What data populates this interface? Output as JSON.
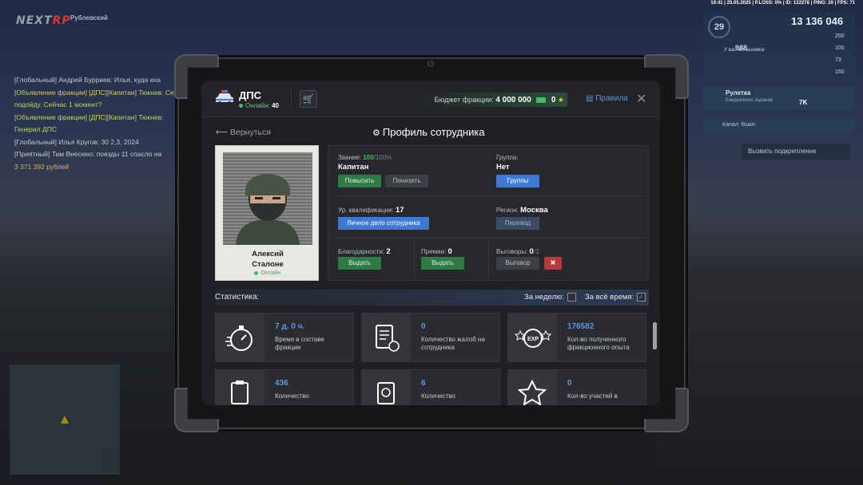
{
  "hud": {
    "logo_a": "NEXT",
    "logo_b": "RP",
    "location": "Рублевский",
    "top": "19:41 | 25.05.2025 | P.LOSS: 0% | ID: 122278 | PING: 20 | FPS: 71",
    "money": "13 136 046",
    "level": "29",
    "score": "988",
    "wanted": "У вас нет вызовов",
    "roulette_title": "Рулетка",
    "roulette_sub": "Ежедневное задание",
    "roulette_val": "7K",
    "channel": "Канал: Выкл.",
    "backup": "Вызвать подкрепление"
  },
  "chat": [
    "[Глобальный] Андрей Бурриев: Илья, куда еха",
    "[Объявление фракции] [ДПС][Капитан] Тюкнев: Сейчас подойду. Сейчас 1 момент?",
    "[Объявление фракции] [ДПС][Капитан] Тюкнев: Генерал ДПС",
    "[Глобальный] Илья Кругов: 30 2,3, 2024",
    "[Приятный] Тим Внесено: поезды 11 спасло на",
    "3 371 392 рублей"
  ],
  "tablet": {
    "faction": "ДПС",
    "online_label": "Онлайн:",
    "online_count": "40",
    "budget_label": "Бюджет фракции:",
    "budget_value": "4 000 000",
    "budget_stars": "0",
    "rules": "Правила",
    "close": "✕",
    "back": "Вернуться",
    "title": "Профиль сотрудника",
    "employee": {
      "first": "Алексий",
      "last": "Сталоне",
      "status": "Онлайн"
    },
    "rank_label": "Звание:",
    "rank_pct": "100",
    "rank_max": "/100%",
    "rank": "Капитан",
    "promote": "Повысить",
    "demote": "Понизить",
    "group_label": "Группа:",
    "group": "Нет",
    "groups_btn": "Группы",
    "qual_label": "Ур. квалификации:",
    "qual": "17",
    "dossier_btn": "Личное дело сотрудника",
    "region_label": "Регион:",
    "region": "Москва",
    "transfer_btn": "Перевод",
    "thanks_label": "Благодарности:",
    "thanks": "2",
    "give": "Выдать",
    "bonus_label": "Премии:",
    "bonus": "0",
    "warn_label": "Выговоры:",
    "warn": "0",
    "warn_max": "/3",
    "warn_btn": "Выговор",
    "stats_label": "Статистика:",
    "week_label": "За неделю:",
    "all_label": "За всё время:",
    "cards": [
      {
        "num": "7 д. 0 ч.",
        "desc": "Время в составе фракции"
      },
      {
        "num": "0",
        "desc": "Количество жалоб на сотрудника"
      },
      {
        "num": "176582",
        "desc": "Кол-во полученного фракционного опыта"
      },
      {
        "num": "436",
        "desc": "Количество"
      },
      {
        "num": "6",
        "desc": "Количество"
      },
      {
        "num": "0",
        "desc": "Кол-во участий в"
      }
    ]
  }
}
